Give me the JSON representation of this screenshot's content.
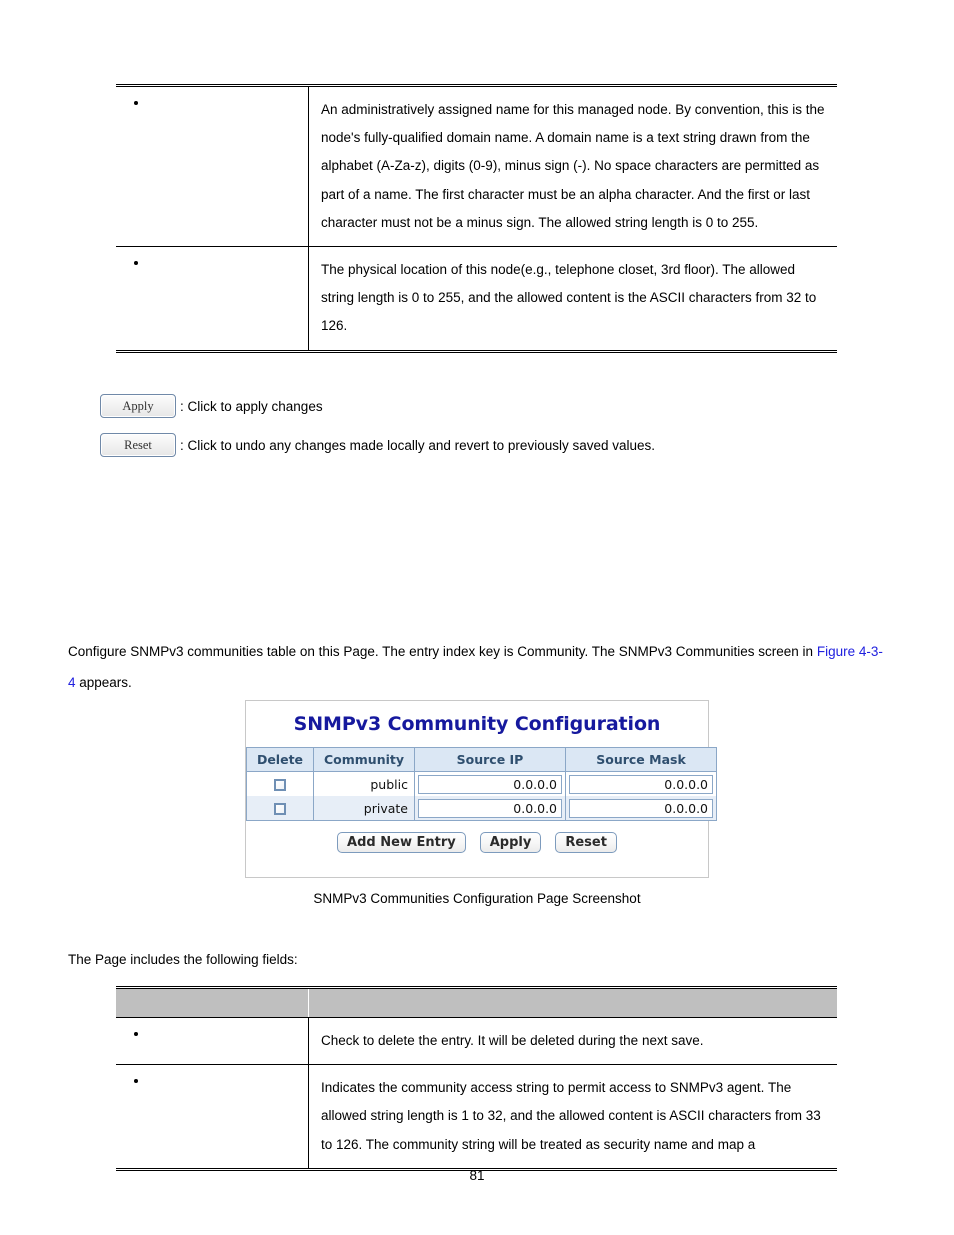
{
  "top_table": {
    "rows": [
      {
        "term": "",
        "description": "An administratively assigned name for this managed node. By convention, this is the node's fully-qualified domain name. A domain name is a text string drawn from the alphabet (A-Za-z), digits (0-9), minus sign (-). No space characters are permitted as part of a name. The first character must be an alpha character. And the first or last character must not be a minus sign. The allowed string length is 0 to 255."
      },
      {
        "term": "",
        "description": "The physical location of this node(e.g., telephone closet, 3rd floor). The allowed string length is 0 to 255, and the allowed content is the ASCII characters from 32 to 126."
      }
    ]
  },
  "buttons_legend": [
    {
      "button_label": "Apply",
      "description": ": Click to apply changes"
    },
    {
      "button_label": "Reset",
      "description": ": Click to undo any changes made locally and revert to previously saved values."
    }
  ],
  "intro_paragraph": {
    "part1": "Configure SNMPv3 communities table on this Page. The entry index key is Community. The SNMPv3 Communities screen in ",
    "link1": "Figure",
    "link2": "4-3-4",
    "part2": " appears."
  },
  "screenshot": {
    "title": "SNMPv3 Community Configuration",
    "table": {
      "headers": [
        "Delete",
        "Community",
        "Source IP",
        "Source Mask"
      ],
      "rows": [
        {
          "delete": "",
          "community": "public",
          "source_ip": "0.0.0.0",
          "source_mask": "0.0.0.0"
        },
        {
          "delete": "",
          "community": "private",
          "source_ip": "0.0.0.0",
          "source_mask": "0.0.0.0"
        }
      ]
    },
    "buttons": [
      "Add New Entry",
      "Apply",
      "Reset"
    ],
    "title_color": "#16199e",
    "header_bg": "#dbe7f4",
    "row_alt_bg": "#e7eef7"
  },
  "figure_caption": "SNMPv3 Communities Configuration Page Screenshot",
  "fields_intro": "The Page includes the following fields:",
  "bottom_table": {
    "header": {
      "col1": "",
      "col2": ""
    },
    "rows": [
      {
        "term": "",
        "description": "Check to delete the entry. It will be deleted during the next save."
      },
      {
        "term": "",
        "description": "Indicates the community access string to permit access to SNMPv3 agent. The allowed string length is 1 to 32, and the allowed content is ASCII characters from 33 to 126. The community string will be treated as security name and map a"
      }
    ]
  },
  "page_number": "81"
}
